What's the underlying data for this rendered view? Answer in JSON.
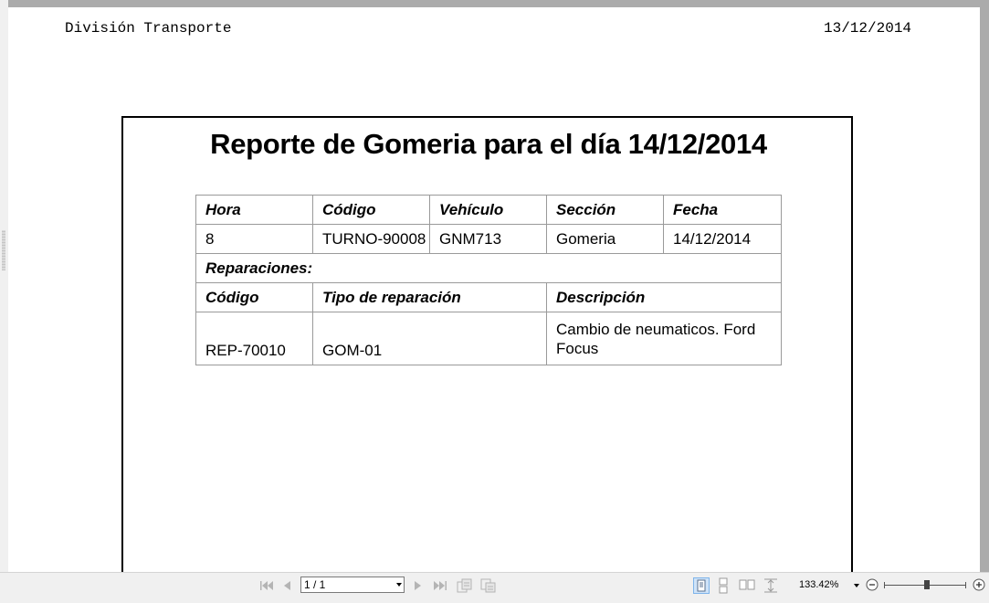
{
  "document": {
    "header_left": "División Transporte",
    "header_right": "13/12/2014",
    "title": "Reporte de Gomeria para el día 14/12/2014"
  },
  "table": {
    "headers": [
      "Hora",
      "Código",
      "Vehículo",
      "Sección",
      "Fecha"
    ],
    "row": [
      "8",
      "TURNO-90008",
      "GNM713",
      "Gomeria",
      "14/12/2014"
    ],
    "section_label": "Reparaciones:",
    "repair_headers": [
      "Código",
      "Tipo de reparación",
      "Descripción"
    ],
    "repair_row": [
      "REP-70010",
      "GOM-01",
      "Cambio de neumaticos. Ford Focus"
    ]
  },
  "toolbar": {
    "page_value": "1 / 1",
    "zoom": "133.42%",
    "icons": [
      "first-page-icon",
      "previous-page-icon",
      "next-page-icon",
      "last-page-icon",
      "export-icon",
      "print-icon",
      "single-page-icon",
      "continuous-icon",
      "two-pages-icon",
      "fit-icon",
      "zoom-out-icon",
      "zoom-in-icon"
    ]
  }
}
